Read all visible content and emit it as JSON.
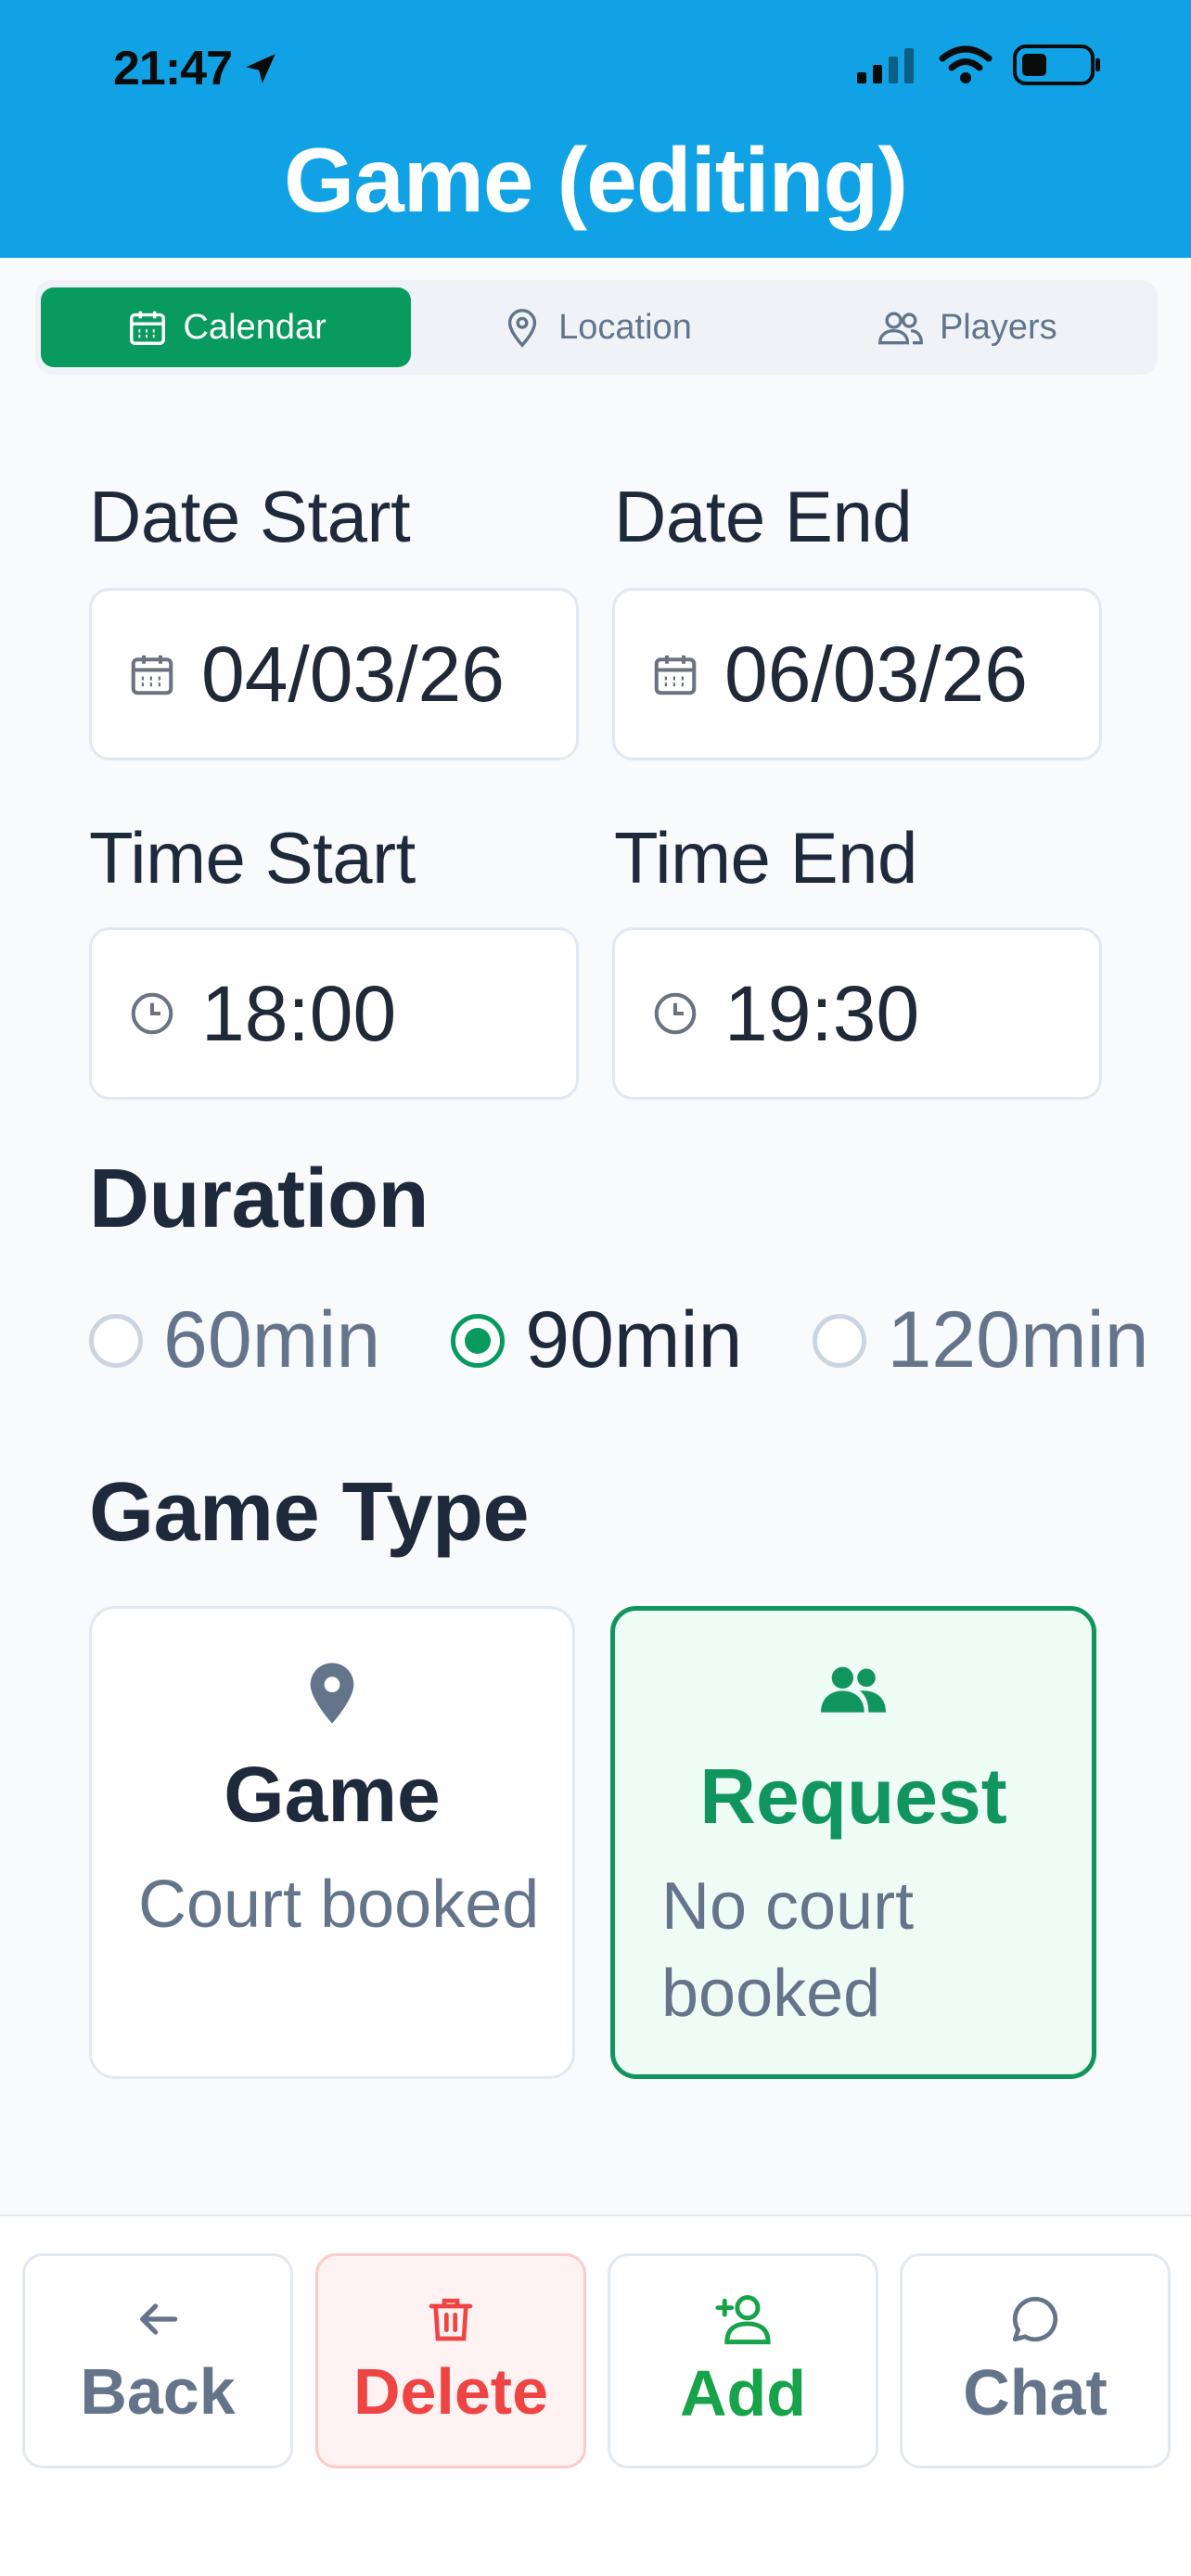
{
  "status_bar": {
    "time": "21:47"
  },
  "header": {
    "title": "Game (editing)"
  },
  "tabs": [
    {
      "label": "Calendar",
      "icon": "calendar-icon",
      "active": true
    },
    {
      "label": "Location",
      "icon": "map-pin-icon",
      "active": false
    },
    {
      "label": "Players",
      "icon": "users-icon",
      "active": false
    }
  ],
  "form": {
    "date_start_label": "Date Start",
    "date_start_value": "04/03/26",
    "date_end_label": "Date End",
    "date_end_value": "06/03/26",
    "time_start_label": "Time Start",
    "time_start_value": "18:00",
    "time_end_label": "Time End",
    "time_end_value": "19:30"
  },
  "duration": {
    "heading": "Duration",
    "options": [
      {
        "label": "60min",
        "selected": false
      },
      {
        "label": "90min",
        "selected": true
      },
      {
        "label": "120min",
        "selected": false
      }
    ]
  },
  "game_type": {
    "heading": "Game Type",
    "cards": [
      {
        "title": "Game",
        "desc": "Court booked",
        "icon": "map-pin-icon",
        "selected": false
      },
      {
        "title": "Request",
        "desc": "No court booked",
        "icon": "users-icon",
        "selected": true
      }
    ]
  },
  "actions": [
    {
      "label": "Back",
      "icon": "arrow-left-icon"
    },
    {
      "label": "Delete",
      "icon": "trash-icon"
    },
    {
      "label": "Add",
      "icon": "user-plus-icon"
    },
    {
      "label": "Chat",
      "icon": "chat-bubble-icon"
    }
  ],
  "colors": {
    "header_blue": "#10a2e4",
    "accent_green": "#099a5f",
    "danger_red": "#ef4444"
  }
}
